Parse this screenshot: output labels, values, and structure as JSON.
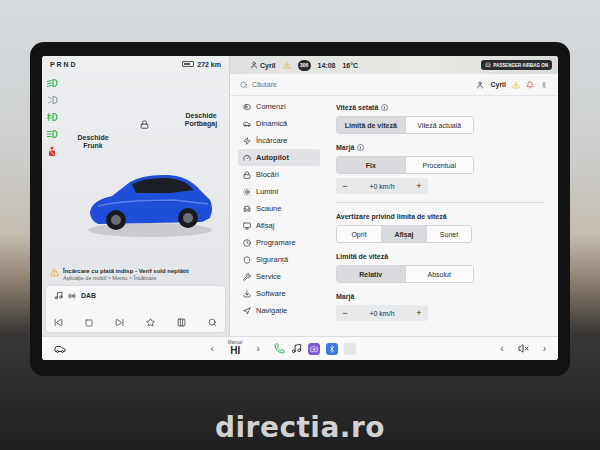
{
  "background": {
    "watermark": "directia.ro"
  },
  "car_panel": {
    "gear": "P R N D",
    "range": "272 km",
    "indicators": [
      {
        "kind": "low-beam",
        "color": "#34b04a"
      },
      {
        "kind": "parking",
        "color": "#9aa0a6"
      },
      {
        "kind": "fog",
        "color": "#34b04a"
      },
      {
        "kind": "high-beam",
        "color": "#34b04a"
      },
      {
        "kind": "seatbelt",
        "color": "#d9362c"
      }
    ],
    "frunk_label": "Deschide Frunk",
    "trunk_label": "Deschide Portbagaj",
    "notification": {
      "title": "Încărcare cu plată indisp - Verif sold neplătit",
      "detail": "Aplicație de mobil > Meniu > Încărcare"
    }
  },
  "media": {
    "source": "DAB"
  },
  "status_bar": {
    "user": "Cyril",
    "badge": "306",
    "time": "14:08",
    "temperature": "16°C",
    "airbag": "PASSENGER AIRBAG ON"
  },
  "search": {
    "placeholder": "Căutare"
  },
  "profile": {
    "name": "Cyril"
  },
  "menu": [
    {
      "label": "Comenzi",
      "selected": false
    },
    {
      "label": "Dinamică",
      "selected": false
    },
    {
      "label": "Încărcare",
      "selected": false
    },
    {
      "label": "Autopilot",
      "selected": true
    },
    {
      "label": "Blocări",
      "selected": false
    },
    {
      "label": "Lumini",
      "selected": false
    },
    {
      "label": "Scaune",
      "selected": false
    },
    {
      "label": "Afișaj",
      "selected": false
    },
    {
      "label": "Programare",
      "selected": false
    },
    {
      "label": "Siguranță",
      "selected": false
    },
    {
      "label": "Service",
      "selected": false
    },
    {
      "label": "Software",
      "selected": false
    },
    {
      "label": "Navigație",
      "selected": false
    }
  ],
  "sections": [
    {
      "groups": [
        {
          "title": "Viteză setată",
          "info": true,
          "controls": [
            {
              "kind": "segmented",
              "options": [
                {
                  "label": "Limită de viteză",
                  "selected": true
                },
                {
                  "label": "Viteză actuală",
                  "selected": false
                }
              ]
            }
          ]
        },
        {
          "title": "Marjă",
          "info": true,
          "controls": [
            {
              "kind": "segmented",
              "options": [
                {
                  "label": "Fix",
                  "selected": true
                },
                {
                  "label": "Procentual",
                  "selected": false
                }
              ]
            },
            {
              "kind": "stepper",
              "minus": "−",
              "value": "+0 km/h",
              "plus": "+"
            }
          ]
        }
      ]
    },
    {
      "groups": [
        {
          "title": "Avertizare privind limita de viteză",
          "info": false,
          "controls": [
            {
              "kind": "segmented",
              "options": [
                {
                  "label": "Oprit",
                  "selected": false
                },
                {
                  "label": "Afișaj",
                  "selected": true
                },
                {
                  "label": "Sunet",
                  "selected": false
                }
              ]
            }
          ]
        },
        {
          "title": "Limită de viteză",
          "info": false,
          "controls": [
            {
              "kind": "segmented",
              "options": [
                {
                  "label": "Relativ",
                  "selected": true
                },
                {
                  "label": "Absolut",
                  "selected": false
                }
              ]
            }
          ]
        },
        {
          "title": "Marjă",
          "info": false,
          "controls": [
            {
              "kind": "stepper",
              "minus": "−",
              "value": "+0 km/h",
              "plus": "+"
            }
          ]
        }
      ]
    }
  ],
  "dock": {
    "prev": "‹",
    "next": "›",
    "climate_mode": "Manual",
    "temperature": "HI",
    "volume_prev": "‹",
    "volume_next": "›"
  }
}
